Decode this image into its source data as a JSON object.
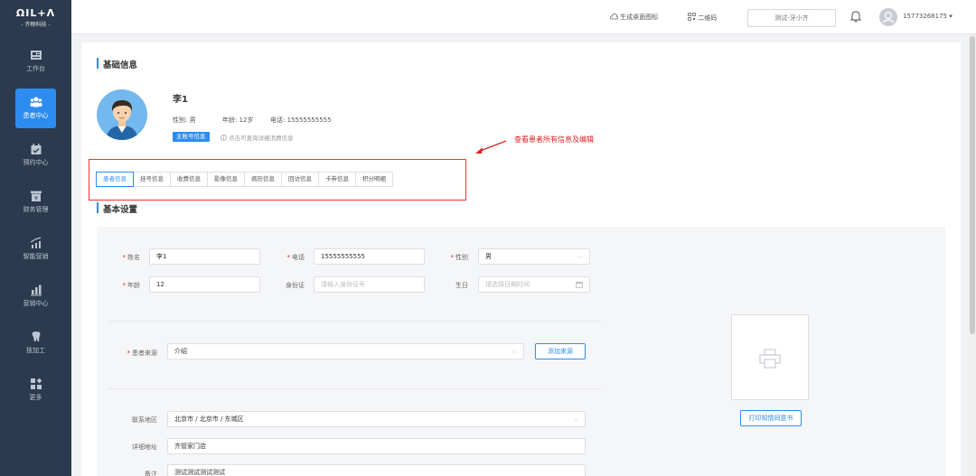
{
  "logo": {
    "brand": "ΩIL+Λ",
    "company": "- 齐畅科技 -"
  },
  "sidebar": {
    "items": [
      {
        "label": "工作台",
        "icon": "dashboard-icon",
        "active": false
      },
      {
        "label": "患者中心",
        "icon": "patients-icon",
        "active": true
      },
      {
        "label": "预约中心",
        "icon": "calendar-icon",
        "active": false
      },
      {
        "label": "财务管理",
        "icon": "finance-icon",
        "active": false
      },
      {
        "label": "智能营销",
        "icon": "marketing-icon",
        "active": false
      },
      {
        "label": "营销中心",
        "icon": "chart-icon",
        "active": false
      },
      {
        "label": "技加工",
        "icon": "tooth-icon",
        "active": false
      },
      {
        "label": "更多",
        "icon": "more-icon",
        "active": false
      }
    ]
  },
  "topbar": {
    "desktop_icon_label": "生成桌面图标",
    "qrcode_label": "二维码",
    "clinic": "测试-牙小齐",
    "phone": "15773268175 ▾"
  },
  "patient": {
    "section_title": "基础信息",
    "name": "李1",
    "gender": "性别: 男",
    "age": "年龄: 12岁",
    "phone": "电话: 15555555555",
    "badge": "主账号信息",
    "hint": "点击可查询详细消费信息"
  },
  "annotation": "查看患者所有信息及编辑",
  "tabs": [
    "患者信息",
    "挂号信息",
    "收费信息",
    "影像信息",
    "病历信息",
    "回访信息",
    "卡券信息",
    "积分明细"
  ],
  "settings": {
    "title": "基本设置",
    "name_label": "姓名",
    "name_value": "李1",
    "phone_label": "电话",
    "phone_value": "15555555555",
    "gender_label": "性别",
    "gender_value": "男",
    "age_label": "年龄",
    "age_value": "12",
    "id_label": "身份证",
    "id_placeholder": "请输入身份证号",
    "birthday_label": "生日",
    "birthday_placeholder": "请选择日期时间",
    "source_label": "患者来源",
    "source_value": "介绍",
    "add_source": "添加来源",
    "region_label": "联系地区",
    "region_value": "北京市 / 北京市 / 东城区",
    "address_label": "详细地址",
    "address_value": "齐管家门店",
    "note_label": "备注",
    "note_value": "测试测试测试测试",
    "print_consent": "打印知情同意书"
  },
  "colors": {
    "sidebar": "#2b3a4e",
    "accent": "#2d8cf0",
    "annotation": "#e02020"
  }
}
